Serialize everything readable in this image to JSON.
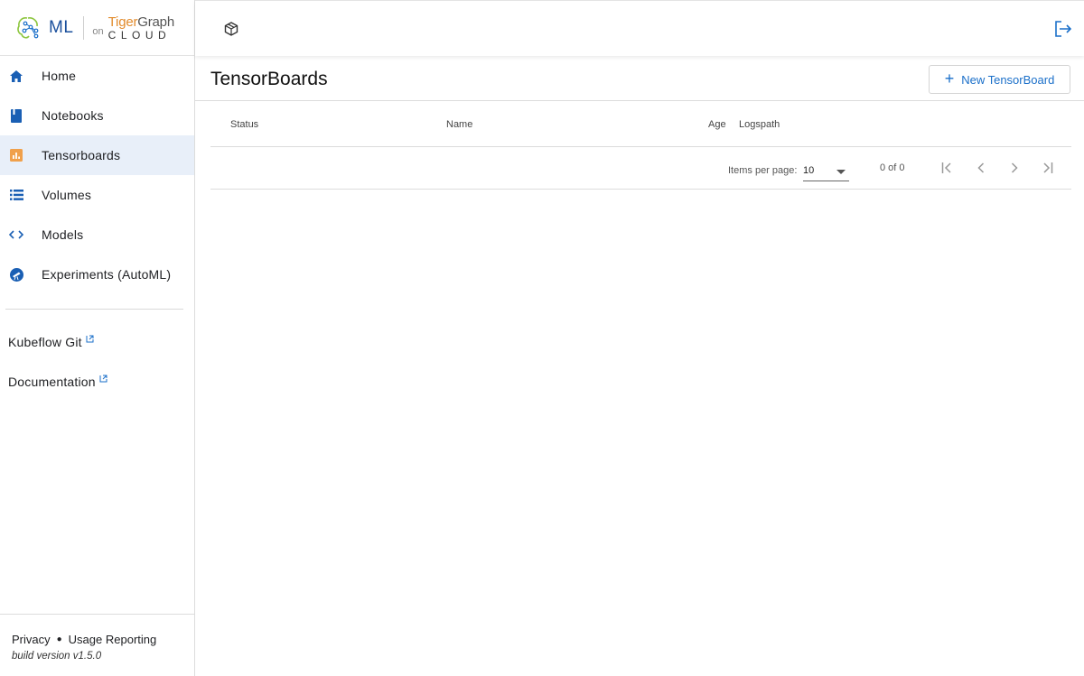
{
  "brand": {
    "ml_label": "ML",
    "on_label": "on",
    "tigergraph_tiger": "Tiger",
    "tigergraph_graph": "Graph",
    "cloud_label": "CLOUD"
  },
  "sidebar": {
    "items": [
      {
        "label": "Home",
        "icon": "home-icon"
      },
      {
        "label": "Notebooks",
        "icon": "book-icon"
      },
      {
        "label": "Tensorboards",
        "icon": "bar-chart-icon",
        "active": true
      },
      {
        "label": "Volumes",
        "icon": "list-icon"
      },
      {
        "label": "Models",
        "icon": "code-icon"
      },
      {
        "label": "Experiments (AutoML)",
        "icon": "experiment-icon"
      }
    ],
    "external_links": [
      {
        "label": "Kubeflow Git"
      },
      {
        "label": "Documentation"
      }
    ],
    "footer": {
      "privacy": "Privacy",
      "usage": "Usage Reporting",
      "build": "build version v1.5.0"
    }
  },
  "main": {
    "title": "TensorBoards",
    "new_button": "New TensorBoard",
    "table": {
      "columns": [
        "Status",
        "Name",
        "Age",
        "Logspath"
      ],
      "rows": []
    },
    "paginator": {
      "items_per_page_label": "Items per page:",
      "items_per_page_value": "10",
      "range_label": "0 of 0"
    }
  },
  "colors": {
    "accent_blue": "#1a6fc9",
    "active_bg": "#e8eff9",
    "brand_orange": "#e28b2c"
  }
}
